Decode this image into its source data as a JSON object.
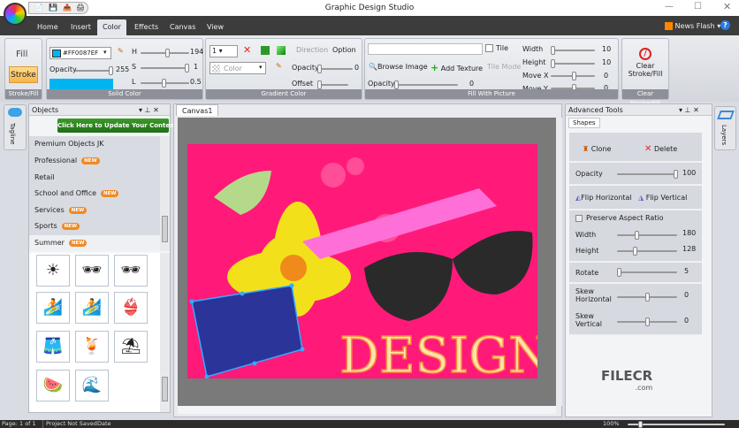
{
  "app": {
    "title": "Graphic Design Studio"
  },
  "ribbon_tabs": [
    "Home",
    "Insert",
    "Color",
    "Effects",
    "Canvas",
    "View"
  ],
  "news_flash": "News Flash",
  "stroke_fill": {
    "fill": "Fill",
    "stroke": "Stroke",
    "label": "Stroke/Fill"
  },
  "solid_color": {
    "hex": "#FF0087EF",
    "opacity_label": "Opacity",
    "opacity": "255",
    "h_label": "H",
    "h": "194",
    "s_label": "S",
    "s": "1",
    "l_label": "L",
    "l": "0.5",
    "label": "Solid Color",
    "swatch": "#00b4ef"
  },
  "gradient": {
    "stops": "1",
    "color_placeholder": "Color",
    "direction": "Direction",
    "option": "Option",
    "opacity_label": "Opacity",
    "opacity": "0",
    "offset_label": "Offset",
    "label": "Gradient Color"
  },
  "picture": {
    "tile": "Tile",
    "browse": "Browse Image",
    "add_texture": "Add Texture",
    "tile_mode": "Tile Mode",
    "opacity_label": "Opacity",
    "opacity": "0",
    "width_label": "Width",
    "width": "10",
    "height_label": "Height",
    "height": "10",
    "movex_label": "Move X",
    "movex": "0",
    "movey_label": "Move Y",
    "movey": "0",
    "label": "Fill With Picture"
  },
  "clear": {
    "button": "Clear Stroke/Fill",
    "label": "Clear Stroke/Fill"
  },
  "tagline_tab": "Tagline",
  "layers_tab": "Layers",
  "objects": {
    "title": "Objects",
    "update_button": "Click Here to Update Your Content",
    "new_badge": "NEW",
    "categories": [
      {
        "name": "Premium Objects JK",
        "new": false
      },
      {
        "name": "Professional",
        "new": true
      },
      {
        "name": "Retail",
        "new": false
      },
      {
        "name": "School and Office",
        "new": true
      },
      {
        "name": "Services",
        "new": true
      },
      {
        "name": "Sports",
        "new": true
      },
      {
        "name": "Summer",
        "new": true
      }
    ],
    "thumbnails": [
      "☀",
      "🕶",
      "🕶",
      "🏄",
      "🏄",
      "👙",
      "🩳",
      "🍹",
      "⛱",
      "🍉",
      "🌊"
    ]
  },
  "canvas": {
    "tab": "Canvas1",
    "art_text": "DESIGN",
    "bg": "#ff1a7a"
  },
  "advanced": {
    "title": "Advanced Tools",
    "tab": "Shapes",
    "clone": "Clone",
    "delete": "Delete",
    "opacity_label": "Opacity",
    "opacity": "100",
    "flip_h": "Flip Horizontal",
    "flip_v": "Flip Vertical",
    "preserve": "Preserve Aspect Ratio",
    "width_label": "Width",
    "width": "180",
    "height_label": "Height",
    "height": "128",
    "rotate_label": "Rotate",
    "rotate": "5",
    "skew_h_label": "Skew Horizontal",
    "skew_h": "0",
    "skew_v_label": "Skew Vertical",
    "skew_v": "0"
  },
  "watermark": {
    "brand": "FILECR",
    "domain": ".com"
  },
  "status": {
    "page": "Page: 1 of 1",
    "project": "Project Not Saved",
    "date": "Date",
    "zoom": "100%"
  }
}
